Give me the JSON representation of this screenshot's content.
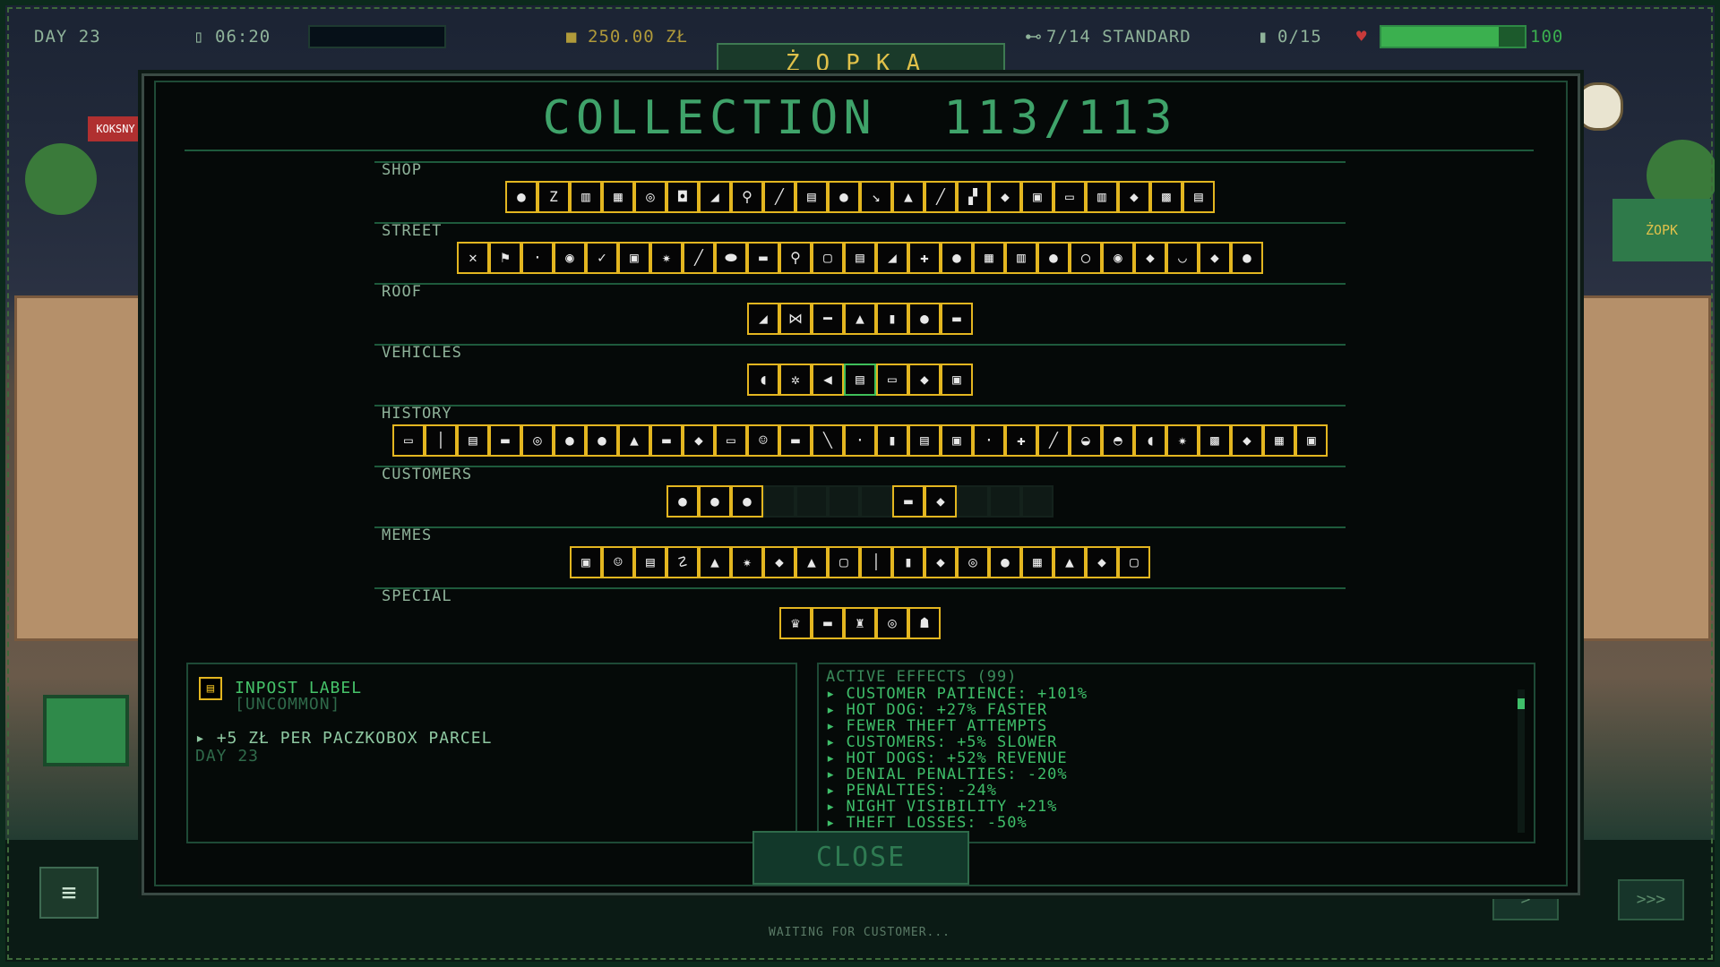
{
  "hud": {
    "day": "DAY 23",
    "time": "06:20",
    "money": "250.00 ZŁ",
    "standard": "7/14 STANDARD",
    "parcels": "0/15",
    "health": "100",
    "health_fraction": 0.82
  },
  "game_title": "ŻOPKA",
  "collection": {
    "title": "COLLECTION",
    "count": "113/113",
    "sections": [
      {
        "label": "SHOP",
        "icons": [
          "●",
          "Z",
          "▥",
          "▦",
          "◎",
          "◘",
          "◢",
          "⚲",
          "╱",
          "▤",
          "●",
          "↘",
          "▲",
          "╱",
          "▞",
          "◆",
          "▣",
          "▭",
          "▥",
          "◆",
          "▩",
          "▤"
        ]
      },
      {
        "label": "STREET",
        "icons": [
          "✕",
          "⚑",
          "·",
          "◉",
          "✓",
          "▣",
          "✷",
          "╱",
          "⬬",
          "▬",
          "⚲",
          "▢",
          "▤",
          "◢",
          "✚",
          "●",
          "▦",
          "▥",
          "●",
          "◯",
          "◉",
          "◆",
          "◡",
          "◆",
          "●"
        ]
      },
      {
        "label": "ROOF",
        "icons": [
          "◢",
          "⋈",
          "━",
          "▲",
          "▮",
          "●",
          "▬"
        ]
      },
      {
        "label": "VEHICLES",
        "icons": [
          "◖",
          "✲",
          "◀",
          "▤",
          "▭",
          "◆",
          "▣"
        ]
      },
      {
        "label": "HISTORY",
        "icons": [
          "▭",
          "│",
          "▤",
          "▬",
          "◎",
          "●",
          "●",
          "▲",
          "▬",
          "◆",
          "▭",
          "☺",
          "▬",
          "╲",
          "·",
          "▮",
          "▤",
          "▣",
          "·",
          "✚",
          "╱",
          "◒",
          "◓",
          "◖",
          "✷",
          "▩",
          "◆",
          "▦",
          "▣"
        ]
      },
      {
        "label": "CUSTOMERS",
        "icons": [
          "●",
          "●",
          "●",
          "",
          "",
          "",
          "",
          "▬",
          "◆",
          "",
          "",
          ""
        ]
      },
      {
        "label": "MEMES",
        "icons": [
          "▣",
          "☺",
          "▤",
          "☡",
          "▲",
          "✷",
          "◆",
          "▲",
          "▢",
          "│",
          "▮",
          "◆",
          "◎",
          "●",
          "▦",
          "▲",
          "◆",
          "▢"
        ]
      },
      {
        "label": "SPECIAL",
        "icons": [
          "♛",
          "▬",
          "♜",
          "◎",
          "☗"
        ]
      }
    ],
    "selected": {
      "section": 3,
      "index": 3
    }
  },
  "selected_item": {
    "name": "INPOST LABEL",
    "rarity": "[UNCOMMON]",
    "effect": "+5 ZŁ PER PACZKOBOX PARCEL",
    "found": "DAY 23"
  },
  "active_effects": {
    "title": "ACTIVE EFFECTS (99)",
    "items": [
      "CUSTOMER PATIENCE: +101%",
      "HOT DOG: +27% FASTER",
      "FEWER THEFT ATTEMPTS",
      "CUSTOMERS: +5% SLOWER",
      "HOT DOGS: +52% REVENUE",
      "DENIAL PENALTIES: -20%",
      "PENALTIES: -24%",
      "NIGHT VISIBILITY +21%",
      "THEFT LOSSES: -50%"
    ]
  },
  "close_label": "CLOSE",
  "background": {
    "sign_text": "KOKSNY",
    "shop_sign": "ŻOPK",
    "status": "WAITING FOR CUSTOMER..."
  }
}
